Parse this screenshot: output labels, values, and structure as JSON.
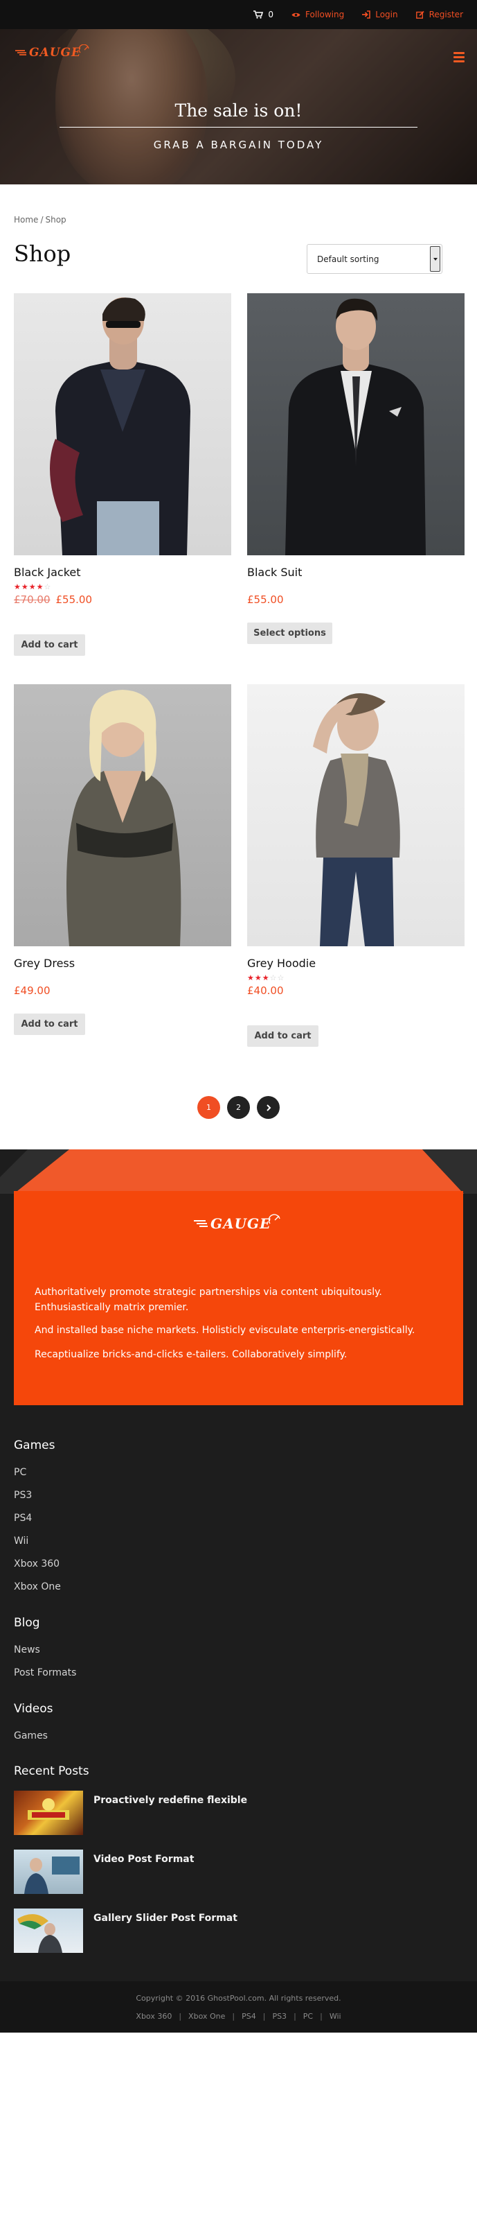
{
  "topbar": {
    "cart_count": "0",
    "following": "Following",
    "login": "Login",
    "register": "Register",
    "accent": "#f04e23"
  },
  "brand": {
    "logo_text": "GAUGE"
  },
  "hero": {
    "title": "The sale is on!",
    "subtitle": "GRAB A BARGAIN TODAY"
  },
  "breadcrumb": {
    "home": "Home",
    "separator": "/",
    "current": "Shop"
  },
  "shop": {
    "title": "Shop",
    "sorting": "Default sorting"
  },
  "products": [
    {
      "name": "Black Jacket",
      "rating": 4,
      "stars": 5,
      "old_price": "£70.00",
      "price": "£55.00",
      "button": "Add to cart"
    },
    {
      "name": "Black Suit",
      "price": "£55.00",
      "button": "Select options"
    },
    {
      "name": "Grey Dress",
      "price": "£49.00",
      "button": "Add to cart"
    },
    {
      "name": "Grey Hoodie",
      "rating": 3,
      "stars": 5,
      "price": "£40.00",
      "button": "Add to cart"
    }
  ],
  "pagination": {
    "pages": [
      "1",
      "2"
    ],
    "current": "1",
    "next_icon": "chevron-right-icon"
  },
  "footer": {
    "logo_text": "GAUGE",
    "about": [
      "Authoritatively promote strategic partnerships via content ubiquitously. Enthusiastically matrix premier.",
      "And installed base niche markets. Holisticly evisculate enterpris-energistically.",
      "Recaptiualize bricks-and-clicks e-tailers. Collaboratively simplify."
    ],
    "games": {
      "title": "Games",
      "links": [
        "PC",
        "PS3",
        "PS4",
        "Wii",
        "Xbox 360",
        "Xbox One"
      ]
    },
    "blog": {
      "title": "Blog",
      "links": [
        "News",
        "Post Formats"
      ]
    },
    "videos": {
      "title": "Videos",
      "links": [
        "Games"
      ]
    },
    "recent": {
      "title": "Recent Posts",
      "posts": [
        "Proactively redefine flexible",
        "Video Post Format",
        "Gallery Slider Post Format"
      ]
    },
    "copyright": "Copyright © 2016 GhostPool.com. All rights reserved.",
    "bottom_links": [
      "Xbox 360",
      "Xbox One",
      "PS4",
      "PS3",
      "PC",
      "Wii"
    ],
    "orange": "#f5470b"
  }
}
